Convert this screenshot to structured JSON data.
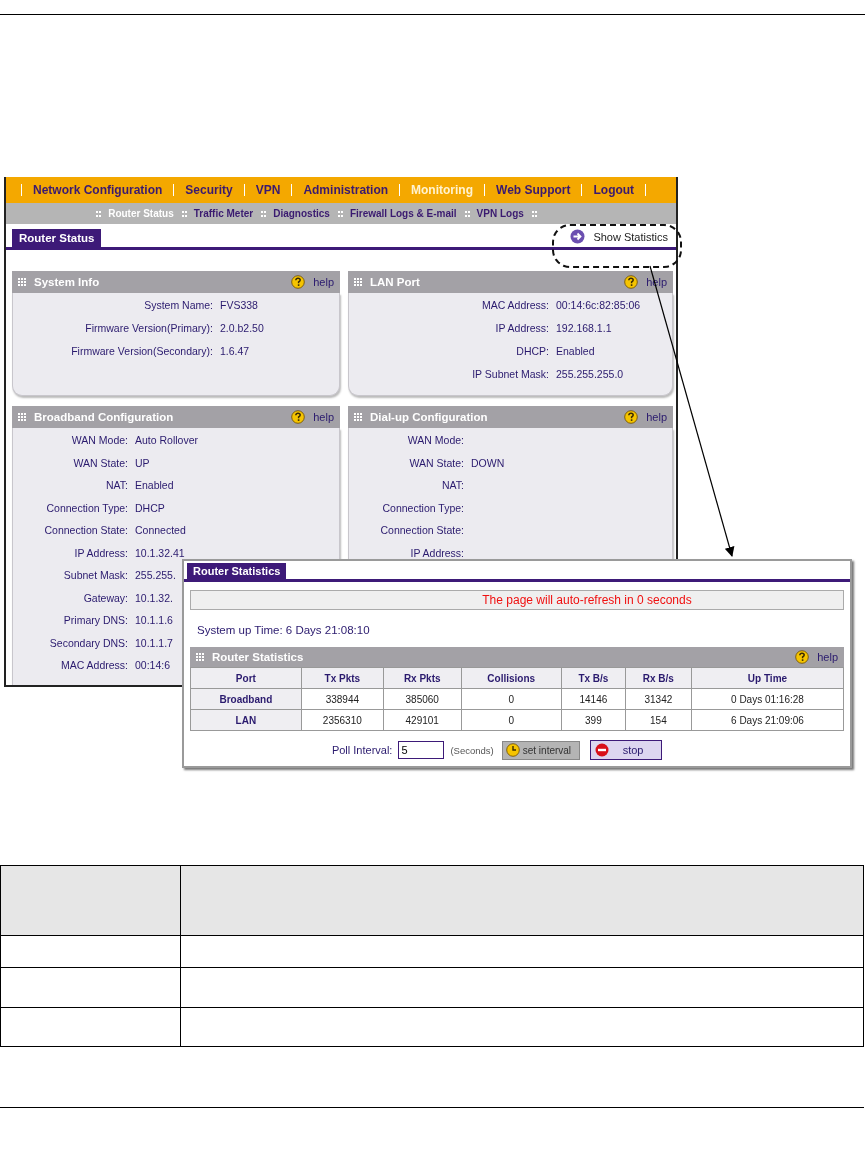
{
  "nav": {
    "items": [
      {
        "label": "Network Configuration",
        "selected": false
      },
      {
        "label": "Security",
        "selected": false
      },
      {
        "label": "VPN",
        "selected": false
      },
      {
        "label": "Administration",
        "selected": false
      },
      {
        "label": "Monitoring",
        "selected": true
      },
      {
        "label": "Web Support",
        "selected": false
      },
      {
        "label": "Logout",
        "selected": false
      }
    ]
  },
  "subnav": {
    "items": [
      {
        "label": "Router Status",
        "selected": true
      },
      {
        "label": "Traffic Meter",
        "selected": false
      },
      {
        "label": "Diagnostics",
        "selected": false
      },
      {
        "label": "Firewall Logs & E-mail",
        "selected": false
      },
      {
        "label": "VPN Logs",
        "selected": false
      }
    ]
  },
  "page_tab": "Router Status",
  "show_statistics": "Show Statistics",
  "panels": [
    {
      "title": "System Info",
      "help": "help",
      "rows": [
        {
          "label": "System Name:",
          "value": "FVS338"
        },
        {
          "label": "Firmware Version(Primary):",
          "value": "2.0.b2.50"
        },
        {
          "label": "Firmware Version(Secondary):",
          "value": "1.6.47"
        }
      ]
    },
    {
      "title": "LAN Port",
      "help": "help",
      "rows": [
        {
          "label": "MAC Address:",
          "value": "00:14:6c:82:85:06"
        },
        {
          "label": "IP Address:",
          "value": "192.168.1.1"
        },
        {
          "label": "DHCP:",
          "value": "Enabled"
        },
        {
          "label": "IP Subnet Mask:",
          "value": "255.255.255.0"
        }
      ]
    },
    {
      "title": "Broadband Configuration",
      "help": "help",
      "rows": [
        {
          "label": "WAN Mode:",
          "value": "Auto Rollover"
        },
        {
          "label": "WAN State:",
          "value": "UP"
        },
        {
          "label": "NAT:",
          "value": "Enabled"
        },
        {
          "label": "Connection Type:",
          "value": "DHCP"
        },
        {
          "label": "Connection State:",
          "value": "Connected"
        },
        {
          "label": "IP Address:",
          "value": "10.1.32.41"
        },
        {
          "label": "Subnet Mask:",
          "value": "255.255."
        },
        {
          "label": "Gateway:",
          "value": "10.1.32."
        },
        {
          "label": "Primary DNS:",
          "value": "10.1.1.6"
        },
        {
          "label": "Secondary DNS:",
          "value": "10.1.1.7"
        },
        {
          "label": "MAC Address:",
          "value": "00:14:6"
        }
      ]
    },
    {
      "title": "Dial-up Configuration",
      "help": "help",
      "rows": [
        {
          "label": "WAN Mode:"
        },
        {
          "label": "WAN State:",
          "value": "DOWN"
        },
        {
          "label": "NAT:"
        },
        {
          "label": "Connection Type:"
        },
        {
          "label": "Connection State:"
        },
        {
          "label": "IP Address:"
        }
      ]
    }
  ],
  "statistics_window": {
    "tab": "Router Statistics",
    "refresh_notice": "The page will auto-refresh in 0 seconds",
    "uptime": "System up Time: 6 Days 21:08:10",
    "section_title": "Router Statistics",
    "help": "help",
    "columns": [
      "Port",
      "Tx Pkts",
      "Rx Pkts",
      "Collisions",
      "Tx B/s",
      "Rx B/s",
      "Up Time"
    ],
    "rows": [
      [
        "Broadband",
        "338944",
        "385060",
        "0",
        "14146",
        "31342",
        "0 Days 01:16:28"
      ],
      [
        "LAN",
        "2356310",
        "429101",
        "0",
        "399",
        "154",
        "6 Days 21:09:06"
      ]
    ],
    "poll_label": "Poll Interval:",
    "poll_value": "5",
    "poll_unit": "(Seconds)",
    "set_button": "set interval",
    "stop_button": "stop"
  }
}
